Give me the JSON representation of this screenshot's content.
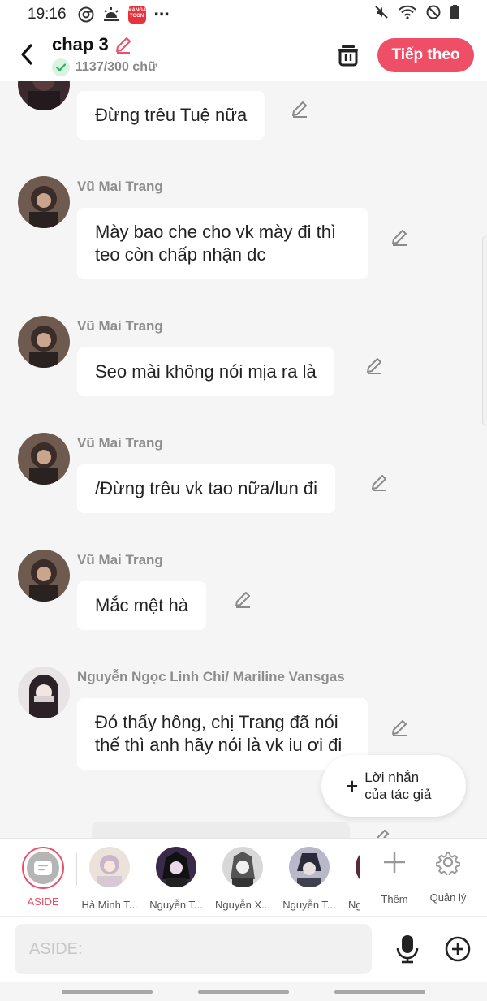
{
  "status_bar": {
    "time": "19:16",
    "app_badge": "MANGA TOON"
  },
  "header": {
    "title": "chap 3",
    "word_count": "1137/300 chữ",
    "next_button": "Tiếp theo"
  },
  "messages": [
    {
      "name": "",
      "text": "Đừng trêu Tuệ nữa"
    },
    {
      "name": "Vũ Mai Trang",
      "text": "Mày bao che cho vk mày đi thì teo còn chấp nhận dc"
    },
    {
      "name": "Vũ Mai Trang",
      "text": "Seo mài không nói mịa ra là"
    },
    {
      "name": "Vũ Mai Trang",
      "text": "/Đừng trêu vk tao nữa/lun đi"
    },
    {
      "name": "Vũ Mai Trang",
      "text": "Mắc mệt hà"
    },
    {
      "name": "Nguyễn Ngọc Linh Chi/ Mariline Vansgas",
      "text": "Đó thấy hông, chị Trang đã nói thế thì anh hãy nói là vk iu ơi đi"
    }
  ],
  "author_note_button": {
    "line1": "Lời nhắn",
    "line2": "của tác giả"
  },
  "characters": {
    "aside_label": "ASIDE",
    "list": [
      {
        "label": "Hà Minh T..."
      },
      {
        "label": "Nguyễn T..."
      },
      {
        "label": "Nguyễn X..."
      },
      {
        "label": "Nguyễn T..."
      },
      {
        "label": "Ng"
      }
    ],
    "add_label": "Thêm",
    "manage_label": "Quản lý"
  },
  "input": {
    "placeholder": "ASIDE:"
  },
  "colors": {
    "accent": "#ee4f66",
    "background": "#f5f5f5",
    "bubble": "#ffffff",
    "name": "#8d8d8d"
  }
}
